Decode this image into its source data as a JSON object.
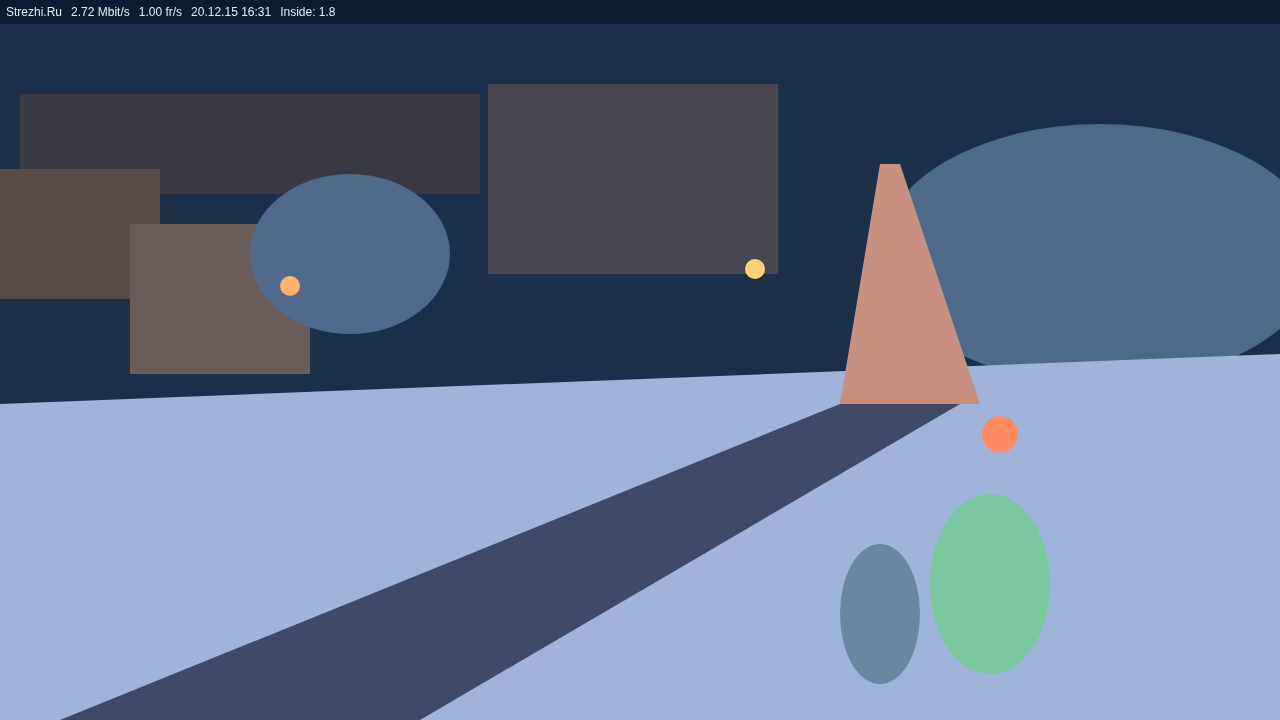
{
  "overlay": {
    "fields": [
      "Strezhi.Ru",
      "2.72 Mbit/s",
      "1.00 fr/s",
      "20.12.15 16:31",
      "Inside: 1.8"
    ]
  }
}
